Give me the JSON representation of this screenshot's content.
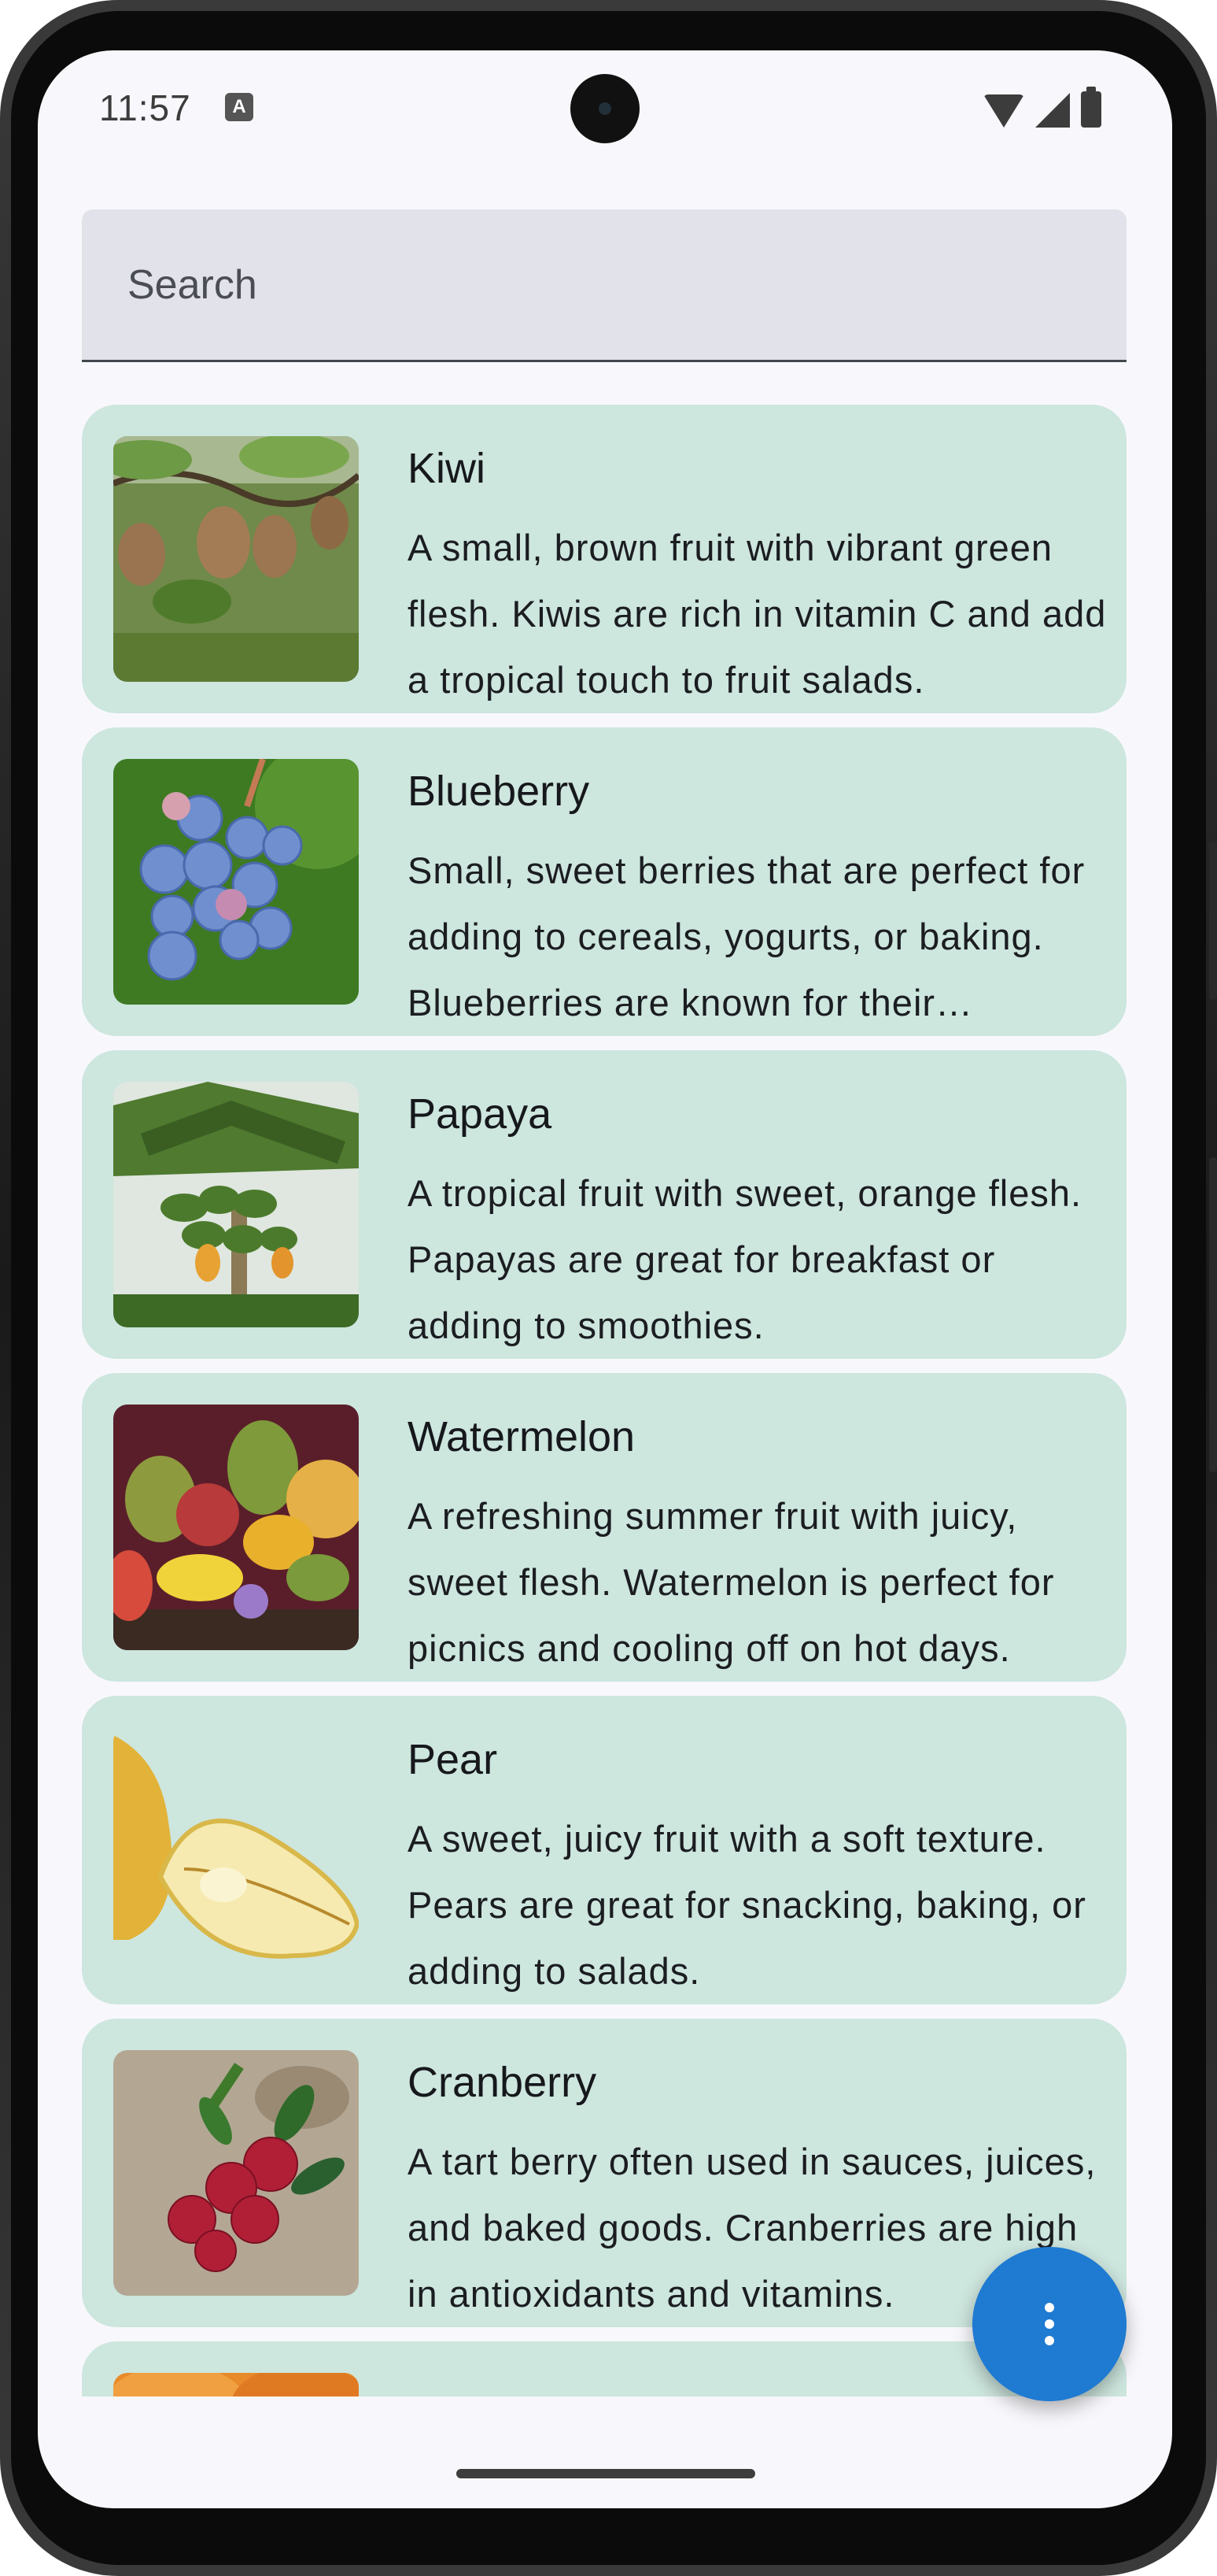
{
  "status_bar": {
    "time": "11:57",
    "notification_glyph": "A",
    "icons": [
      "wifi-icon",
      "signal-icon",
      "battery-icon"
    ]
  },
  "search": {
    "placeholder": "Search",
    "value": ""
  },
  "fruits": [
    {
      "name": "Kiwi",
      "description": "A small, brown fruit with vibrant green flesh. Kiwis are rich in vitamin C and add a tropical touch to fruit salads.",
      "image": "kiwi-image"
    },
    {
      "name": "Blueberry",
      "description": "Small, sweet berries that are perfect for adding to cereals, yogurts, or baking. Blueberries are known for their antioxidants.",
      "image": "blueberry-image"
    },
    {
      "name": "Papaya",
      "description": "A tropical fruit with sweet, orange flesh. Papayas are great for breakfast or adding to smoothies.",
      "image": "papaya-image"
    },
    {
      "name": "Watermelon",
      "description": "A refreshing summer fruit with juicy, sweet flesh. Watermelon is perfect for picnics and cooling off on hot days.",
      "image": "watermelon-image"
    },
    {
      "name": "Pear",
      "description": "A sweet, juicy fruit with a soft texture. Pears are great for snacking, baking, or adding to salads.",
      "image": "pear-image"
    },
    {
      "name": "Cranberry",
      "description": "A tart berry often used in sauces, juices, and baked goods. Cranberries are high in antioxidants and vitamins.",
      "image": "cranberry-image"
    },
    {
      "name": "",
      "description": "",
      "image": "apricot-image"
    }
  ],
  "fab": {
    "icon": "more-vert-icon"
  },
  "colors": {
    "card_background": "#cde6de",
    "search_background": "#e2e2ea",
    "fab": "#1f7ad2",
    "screen_background": "#f8f8fc"
  }
}
